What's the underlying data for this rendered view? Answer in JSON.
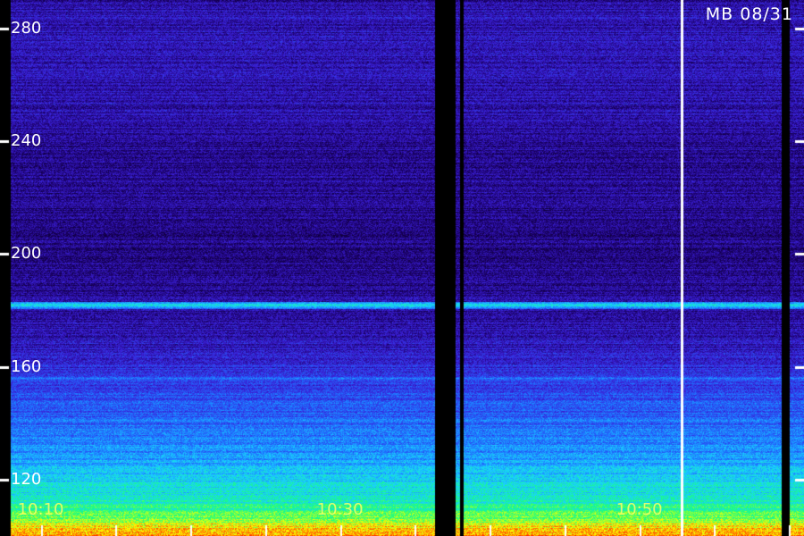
{
  "station_label": "MB 08/31",
  "colors": {
    "background": "#000000",
    "tick_and_label": "#ffffff",
    "time_label": "#ffff66",
    "colormap": [
      "#000000",
      "#1a0066",
      "#3a1fd6",
      "#1f6fff",
      "#19d2ff",
      "#1aff7a",
      "#ffff00",
      "#ff3300"
    ]
  },
  "chart_data": {
    "type": "heatmap",
    "title": "",
    "xlabel": "",
    "ylabel": "",
    "ylim": [
      100,
      290
    ],
    "y_ticks": [
      120,
      160,
      200,
      240,
      280
    ],
    "y_tick_labels": [
      "120",
      "160",
      "200",
      "240",
      "280"
    ],
    "x_time_labels": [
      "10:10",
      "10:30",
      "10:50"
    ],
    "xlim": [
      "10:08:00",
      "11:01:00"
    ],
    "minor_x_tick_interval_minutes": 5,
    "bright_bands": [
      {
        "y": 182,
        "description_level": 0.62
      },
      {
        "y": 156,
        "description_level": 0.45
      }
    ],
    "signal_gaps": [
      {
        "start": "10:36:20",
        "end": "10:37:40"
      },
      {
        "start": "10:38:00",
        "end": "10:38:15"
      },
      {
        "start": "10:59:30",
        "end": "11:00:00"
      }
    ],
    "reference_line_time": "10:52:50",
    "intensity_profile": [
      {
        "y": 100,
        "level": 0.95
      },
      {
        "y": 104,
        "level": 0.85
      },
      {
        "y": 108,
        "level": 0.72
      },
      {
        "y": 114,
        "level": 0.62
      },
      {
        "y": 122,
        "level": 0.55
      },
      {
        "y": 130,
        "level": 0.48
      },
      {
        "y": 140,
        "level": 0.42
      },
      {
        "y": 150,
        "level": 0.36
      },
      {
        "y": 160,
        "level": 0.3
      },
      {
        "y": 170,
        "level": 0.24
      },
      {
        "y": 185,
        "level": 0.2
      },
      {
        "y": 200,
        "level": 0.18
      },
      {
        "y": 220,
        "level": 0.19
      },
      {
        "y": 240,
        "level": 0.21
      },
      {
        "y": 260,
        "level": 0.23
      },
      {
        "y": 280,
        "level": 0.24
      },
      {
        "y": 290,
        "level": 0.22
      }
    ]
  }
}
